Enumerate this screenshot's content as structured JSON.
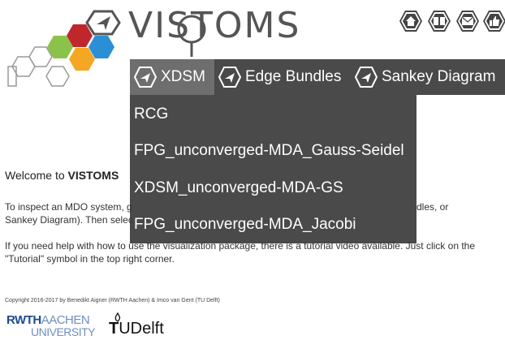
{
  "logo": {
    "title": "VISTOMS"
  },
  "top_icons": [
    {
      "icon": "home-icon"
    },
    {
      "icon": "book-icon"
    },
    {
      "icon": "mail-icon"
    },
    {
      "icon": "thumbs-up-icon"
    }
  ],
  "nav": {
    "items": [
      {
        "label": "XDSM",
        "active": true
      },
      {
        "label": "Edge Bundles",
        "active": false
      },
      {
        "label": "Sankey Diagram",
        "active": false
      }
    ]
  },
  "dropdown": {
    "items": [
      "RCG",
      "FPG_unconverged-MDA_Gauss-Seidel",
      "XDSM_unconverged-MDA-GS",
      "FPG_unconverged-MDA_Jacobi"
    ]
  },
  "content": {
    "welcome_prefix": "Welcome to ",
    "welcome_bold": "VISTOMS",
    "para1_line1_start": "To inspect an MDO system, g",
    "para1_line1_end": "dles, or",
    "para1_line2": "Sankey Diagram). Then selec",
    "para2_line1": "If you need help with how to use the visualization package, there is a tutorial video available. Just click on the",
    "para2_line2": "\"Tutorial\" symbol in the top right corner.",
    "copyright": "Copyright 2016-2017 by Benedikt Aigner (RWTH Aachen) & Imco van Gent (TU Delft)"
  },
  "footer": {
    "rwth_bold": "RWTH",
    "rwth_light": "AACHEN",
    "rwth_bottom": "UNIVERSITY",
    "tud_t": "T",
    "tud_rest": "UDelft"
  },
  "colors": {
    "nav_bg": "#4a4a4a",
    "nav_active": "#6e6e6e",
    "hex_red": "#c0272d",
    "hex_green": "#8bc34a",
    "hex_orange": "#f5a623",
    "hex_blue": "#2b8fd6"
  }
}
